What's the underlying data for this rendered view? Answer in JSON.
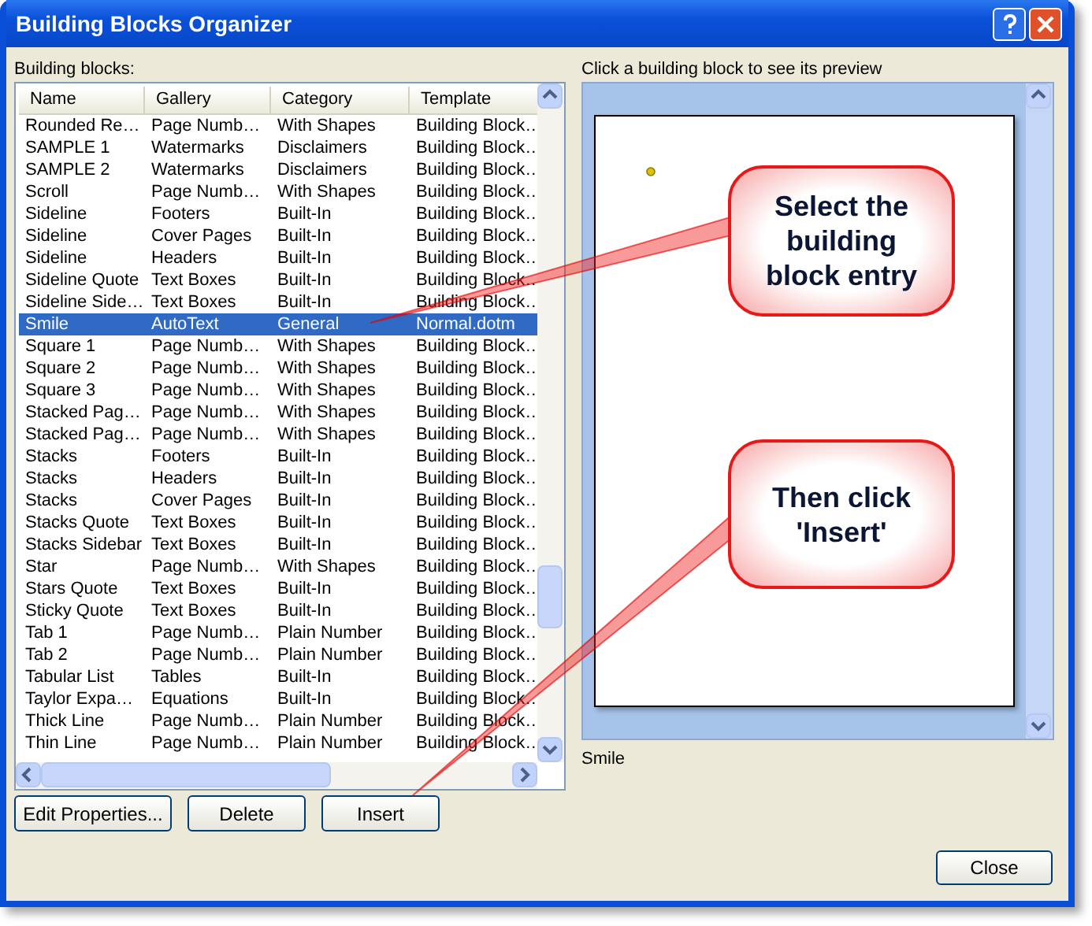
{
  "window": {
    "title": "Building Blocks Organizer"
  },
  "list": {
    "label": "Building blocks:",
    "columns": [
      "Name",
      "Gallery",
      "Category",
      "Template"
    ],
    "rows": [
      {
        "cells": [
          "Rounded Re…",
          "Page Numb…",
          "With Shapes",
          "Building Block…"
        ],
        "selected": false
      },
      {
        "cells": [
          "SAMPLE 1",
          "Watermarks",
          "Disclaimers",
          "Building Block…"
        ],
        "selected": false
      },
      {
        "cells": [
          "SAMPLE 2",
          "Watermarks",
          "Disclaimers",
          "Building Block…"
        ],
        "selected": false
      },
      {
        "cells": [
          "Scroll",
          "Page Numb…",
          "With Shapes",
          "Building Block…"
        ],
        "selected": false
      },
      {
        "cells": [
          "Sideline",
          "Footers",
          "Built-In",
          "Building Block…"
        ],
        "selected": false
      },
      {
        "cells": [
          "Sideline",
          "Cover Pages",
          "Built-In",
          "Building Block…"
        ],
        "selected": false
      },
      {
        "cells": [
          "Sideline",
          "Headers",
          "Built-In",
          "Building Block…"
        ],
        "selected": false
      },
      {
        "cells": [
          "Sideline Quote",
          "Text Boxes",
          "Built-In",
          "Building Block…"
        ],
        "selected": false
      },
      {
        "cells": [
          "Sideline Side…",
          "Text Boxes",
          "Built-In",
          "Building Block…"
        ],
        "selected": false
      },
      {
        "cells": [
          "Smile",
          "AutoText",
          "General",
          "Normal.dotm"
        ],
        "selected": true
      },
      {
        "cells": [
          "Square 1",
          "Page Numb…",
          "With Shapes",
          "Building Block…"
        ],
        "selected": false
      },
      {
        "cells": [
          "Square 2",
          "Page Numb…",
          "With Shapes",
          "Building Block…"
        ],
        "selected": false
      },
      {
        "cells": [
          "Square 3",
          "Page Numb…",
          "With Shapes",
          "Building Block…"
        ],
        "selected": false
      },
      {
        "cells": [
          "Stacked Pag…",
          "Page Numb…",
          "With Shapes",
          "Building Block…"
        ],
        "selected": false
      },
      {
        "cells": [
          "Stacked Pag…",
          "Page Numb…",
          "With Shapes",
          "Building Block…"
        ],
        "selected": false
      },
      {
        "cells": [
          "Stacks",
          "Footers",
          "Built-In",
          "Building Block…"
        ],
        "selected": false
      },
      {
        "cells": [
          "Stacks",
          "Headers",
          "Built-In",
          "Building Block…"
        ],
        "selected": false
      },
      {
        "cells": [
          "Stacks",
          "Cover Pages",
          "Built-In",
          "Building Block…"
        ],
        "selected": false
      },
      {
        "cells": [
          "Stacks Quote",
          "Text Boxes",
          "Built-In",
          "Building Block…"
        ],
        "selected": false
      },
      {
        "cells": [
          "Stacks Sidebar",
          "Text Boxes",
          "Built-In",
          "Building Block…"
        ],
        "selected": false
      },
      {
        "cells": [
          "Star",
          "Page Numb…",
          "With Shapes",
          "Building Block…"
        ],
        "selected": false
      },
      {
        "cells": [
          "Stars Quote",
          "Text Boxes",
          "Built-In",
          "Building Block…"
        ],
        "selected": false
      },
      {
        "cells": [
          "Sticky Quote",
          "Text Boxes",
          "Built-In",
          "Building Block…"
        ],
        "selected": false
      },
      {
        "cells": [
          "Tab 1",
          "Page Numb…",
          "Plain Number",
          "Building Block…"
        ],
        "selected": false
      },
      {
        "cells": [
          "Tab 2",
          "Page Numb…",
          "Plain Number",
          "Building Block…"
        ],
        "selected": false
      },
      {
        "cells": [
          "Tabular List",
          "Tables",
          "Built-In",
          "Building Block…"
        ],
        "selected": false
      },
      {
        "cells": [
          "Taylor Expa…",
          "Equations",
          "Built-In",
          "Building Block…"
        ],
        "selected": false
      },
      {
        "cells": [
          "Thick Line",
          "Page Numb…",
          "Plain Number",
          "Building Block…"
        ],
        "selected": false
      },
      {
        "cells": [
          "Thin Line",
          "Page Numb…",
          "Plain Number",
          "Building Block…"
        ],
        "selected": false
      }
    ]
  },
  "preview": {
    "label": "Click a building block to see its preview",
    "caption": "Smile"
  },
  "buttons": [
    "Edit Properties...",
    "Delete",
    "Insert"
  ],
  "close_button": "Close",
  "callouts": [
    {
      "text": "Select the building block entry"
    },
    {
      "text": "Then click 'Insert'"
    }
  ]
}
